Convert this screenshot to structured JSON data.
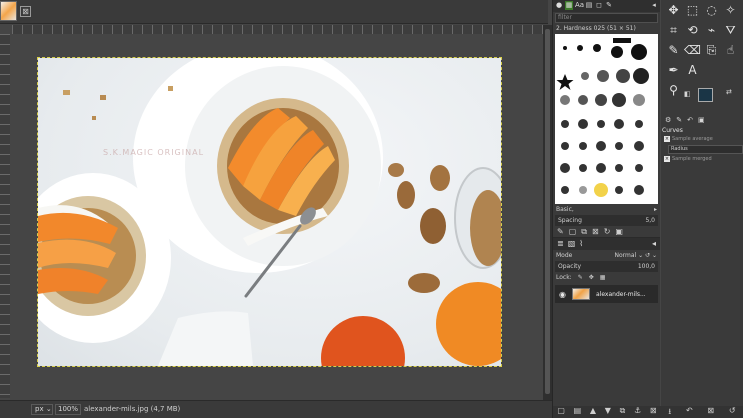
{
  "tab": {
    "close_glyph": "⊠"
  },
  "canvas": {
    "watermark_text": "S.K.MAGIC ORIGINAL",
    "image_alt": "Overhead food photo: two white bowls of granola and yogurt topped with persimmon slices, walnuts and a spoon",
    "guide_color": "#d8d04a"
  },
  "statusbar": {
    "unit": "px",
    "zoom": "100%",
    "file_info": "alexander-mils.jpg (4,7 MB)"
  },
  "brushes": {
    "filter_placeholder": "filter",
    "title": "2. Hardness 025 (51 × 51)",
    "preset": "Basic,",
    "spacing_label": "Spacing",
    "spacing_value": "5,0"
  },
  "layers": {
    "mode_label": "Mode",
    "mode_value": "Normal",
    "opacity_label": "Opacity",
    "opacity_value": "100,0",
    "lock_label": "Lock:",
    "layer_name": "alexander-mils..."
  },
  "tool_options": {
    "title": "Curves",
    "sample_average": "Sample average",
    "radius_label": "Radius",
    "sample_merged": "Sample merged"
  },
  "colors": {
    "foreground": "#1a3546",
    "background": "#ffffff",
    "accent_orange": "#f28a2a"
  }
}
